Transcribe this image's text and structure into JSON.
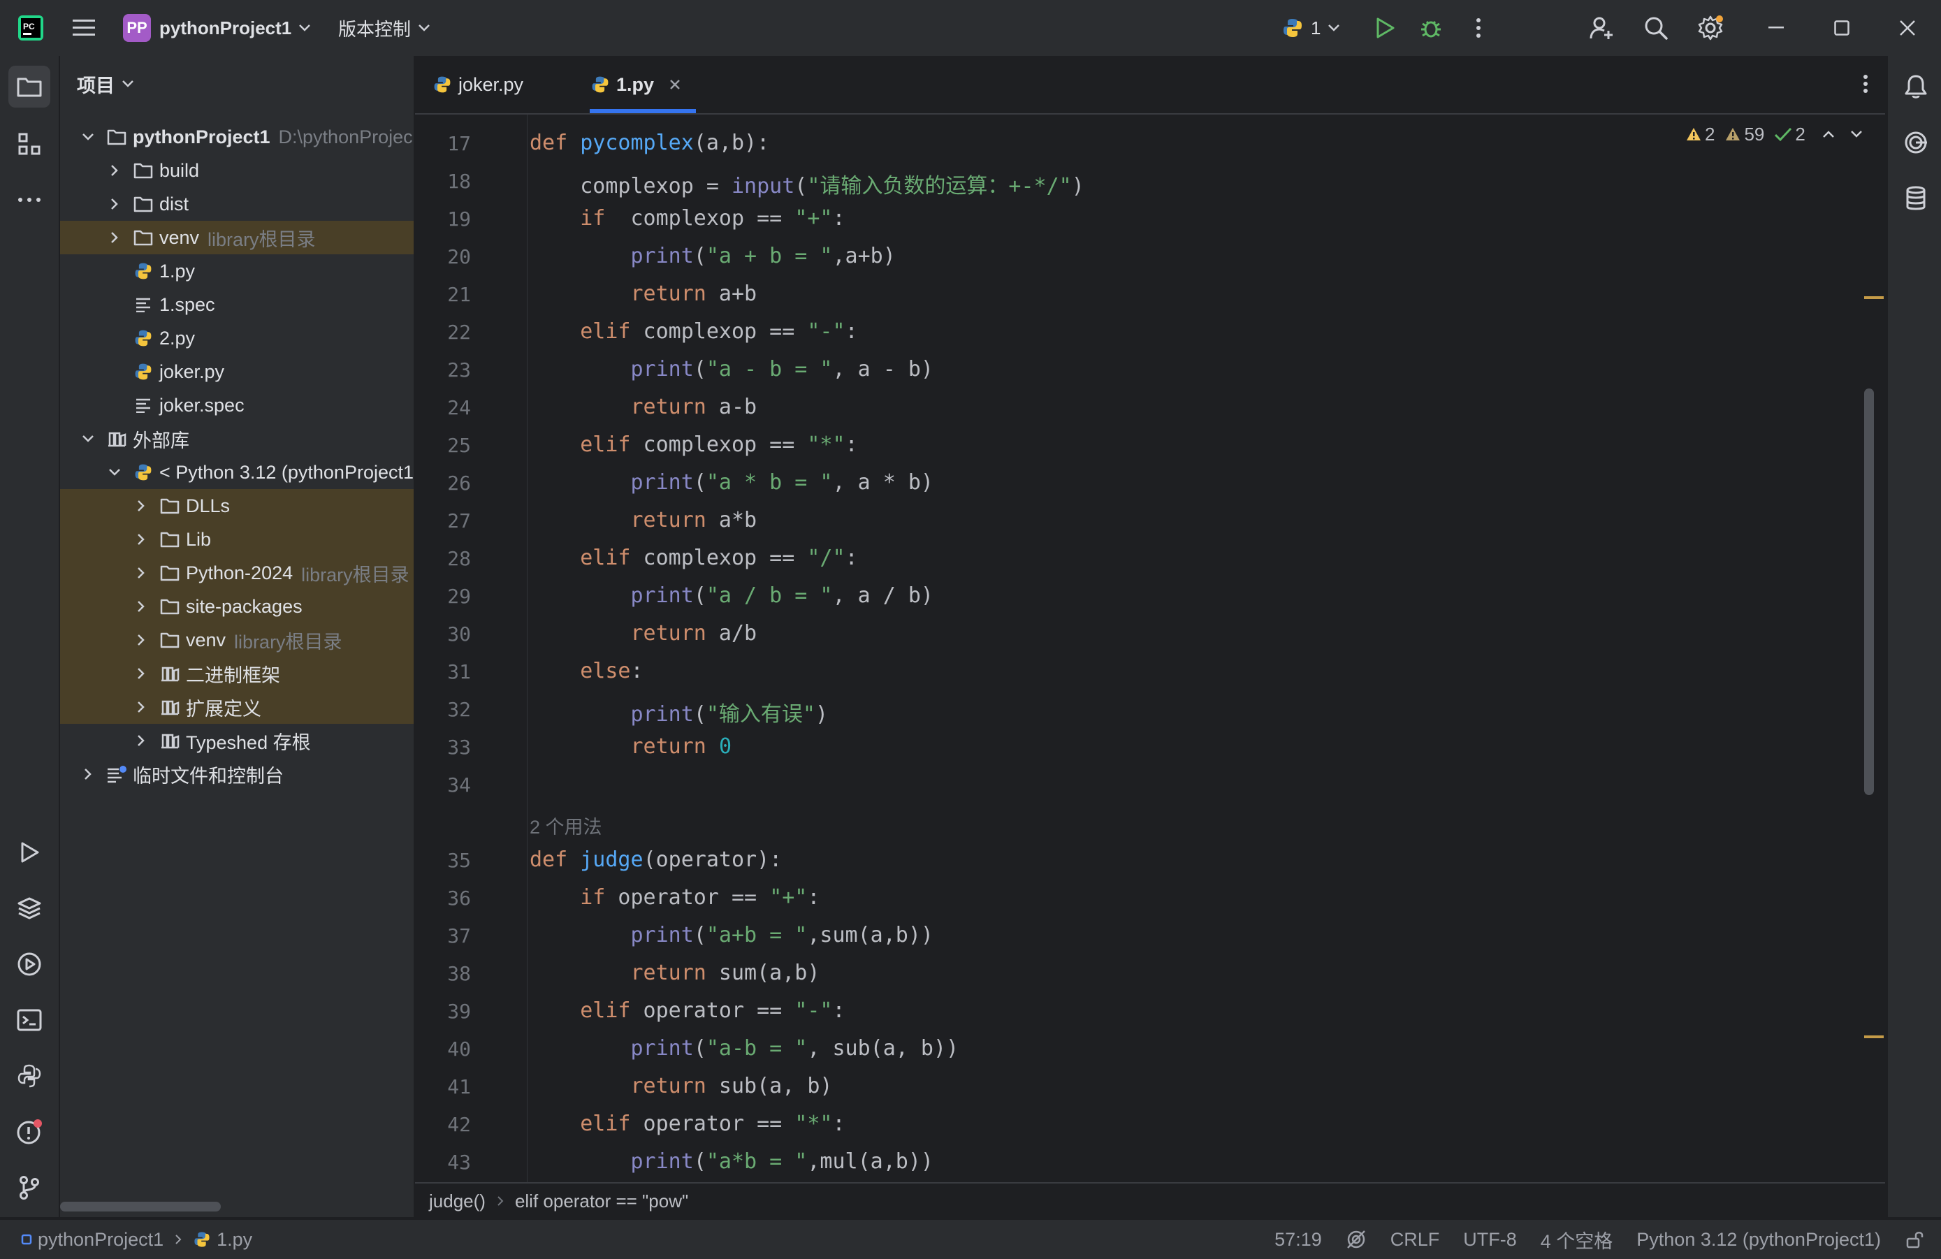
{
  "window": {
    "project_initials": "PP",
    "project_name": "pythonProject1",
    "vcs_menu": "版本控制",
    "run_config": "1"
  },
  "colors": {
    "background": "#1e1f22",
    "panel": "#2b2d30",
    "tree_highlight": "#493f27",
    "accent": "#3574f0",
    "keyword": "#cf8e6d",
    "function": "#56a8f5",
    "builtin": "#8888c6",
    "string": "#6aab73",
    "number": "#2aacb8"
  },
  "project_panel": {
    "title": "项目",
    "tree": [
      {
        "label": "pythonProject1",
        "suffix": "D:\\pythonProjec",
        "icon": "folder-icon"
      },
      {
        "label": "build",
        "icon": "folder-icon"
      },
      {
        "label": "dist",
        "icon": "folder-icon"
      },
      {
        "label": "venv",
        "suffix": "library根目录",
        "icon": "folder-icon"
      },
      {
        "label": "1.py",
        "icon": "python-file-icon"
      },
      {
        "label": "1.spec",
        "icon": "text-file-icon"
      },
      {
        "label": "2.py",
        "icon": "python-file-icon"
      },
      {
        "label": "joker.py",
        "icon": "python-file-icon"
      },
      {
        "label": "joker.spec",
        "icon": "text-file-icon"
      },
      {
        "label": "外部库",
        "icon": "library-icon"
      },
      {
        "label": "< Python 3.12 (pythonProject1",
        "icon": "python-sdk-icon"
      },
      {
        "label": "DLLs",
        "icon": "folder-icon"
      },
      {
        "label": "Lib",
        "icon": "folder-icon"
      },
      {
        "label": "Python-2024",
        "suffix": "library根目录",
        "icon": "folder-icon"
      },
      {
        "label": "site-packages",
        "icon": "folder-icon"
      },
      {
        "label": "venv",
        "suffix": "library根目录",
        "icon": "folder-icon"
      },
      {
        "label": "二进制框架",
        "icon": "library-icon"
      },
      {
        "label": "扩展定义",
        "icon": "library-icon"
      },
      {
        "label": "Typeshed 存根",
        "icon": "library-icon"
      },
      {
        "label": "临时文件和控制台",
        "icon": "scratches-icon"
      }
    ]
  },
  "tabs": [
    {
      "label": "joker.py",
      "active": false
    },
    {
      "label": "1.py",
      "active": true
    }
  ],
  "inspections": {
    "warnings_strong": "2",
    "warnings_weak": "59",
    "ok": "2"
  },
  "code": {
    "lines": [
      {
        "n": "17",
        "text": "def pycomplex(a,b):"
      },
      {
        "n": "18",
        "text": "    complexop = input(\"请输入负数的运算：+-*/\")"
      },
      {
        "n": "19",
        "text": "    if  complexop == \"+\":"
      },
      {
        "n": "20",
        "text": "        print(\"a + b = \",a+b)"
      },
      {
        "n": "21",
        "text": "        return a+b"
      },
      {
        "n": "22",
        "text": "    elif complexop == \"-\":"
      },
      {
        "n": "23",
        "text": "        print(\"a - b = \", a - b)"
      },
      {
        "n": "24",
        "text": "        return a-b"
      },
      {
        "n": "25",
        "text": "    elif complexop == \"*\":"
      },
      {
        "n": "26",
        "text": "        print(\"a * b = \", a * b)"
      },
      {
        "n": "27",
        "text": "        return a*b"
      },
      {
        "n": "28",
        "text": "    elif complexop == \"/\":"
      },
      {
        "n": "29",
        "text": "        print(\"a / b = \", a / b)"
      },
      {
        "n": "30",
        "text": "        return a/b"
      },
      {
        "n": "31",
        "text": "    else:"
      },
      {
        "n": "32",
        "text": "        print(\"输入有误\")"
      },
      {
        "n": "33",
        "text": "        return 0"
      },
      {
        "n": "34",
        "text": ""
      },
      {
        "n": "",
        "text": "2 个用法"
      },
      {
        "n": "35",
        "text": "def judge(operator):"
      },
      {
        "n": "36",
        "text": "    if operator == \"+\":"
      },
      {
        "n": "37",
        "text": "        print(\"a+b = \",sum(a,b))"
      },
      {
        "n": "38",
        "text": "        return sum(a,b)"
      },
      {
        "n": "39",
        "text": "    elif operator == \"-\":"
      },
      {
        "n": "40",
        "text": "        print(\"a-b = \", sub(a, b))"
      },
      {
        "n": "41",
        "text": "        return sub(a, b)"
      },
      {
        "n": "42",
        "text": "    elif operator == \"*\":"
      },
      {
        "n": "43",
        "text": "        print(\"a*b = \",mul(a,b))"
      }
    ]
  },
  "breadcrumb": {
    "item1": "judge()",
    "item2": "elif operator == \"pow\""
  },
  "statusbar": {
    "path1": "pythonProject1",
    "path2": "1.py",
    "position": "57:19",
    "line_ending": "CRLF",
    "encoding": "UTF-8",
    "indent": "4 个空格",
    "interpreter": "Python 3.12 (pythonProject1)"
  }
}
